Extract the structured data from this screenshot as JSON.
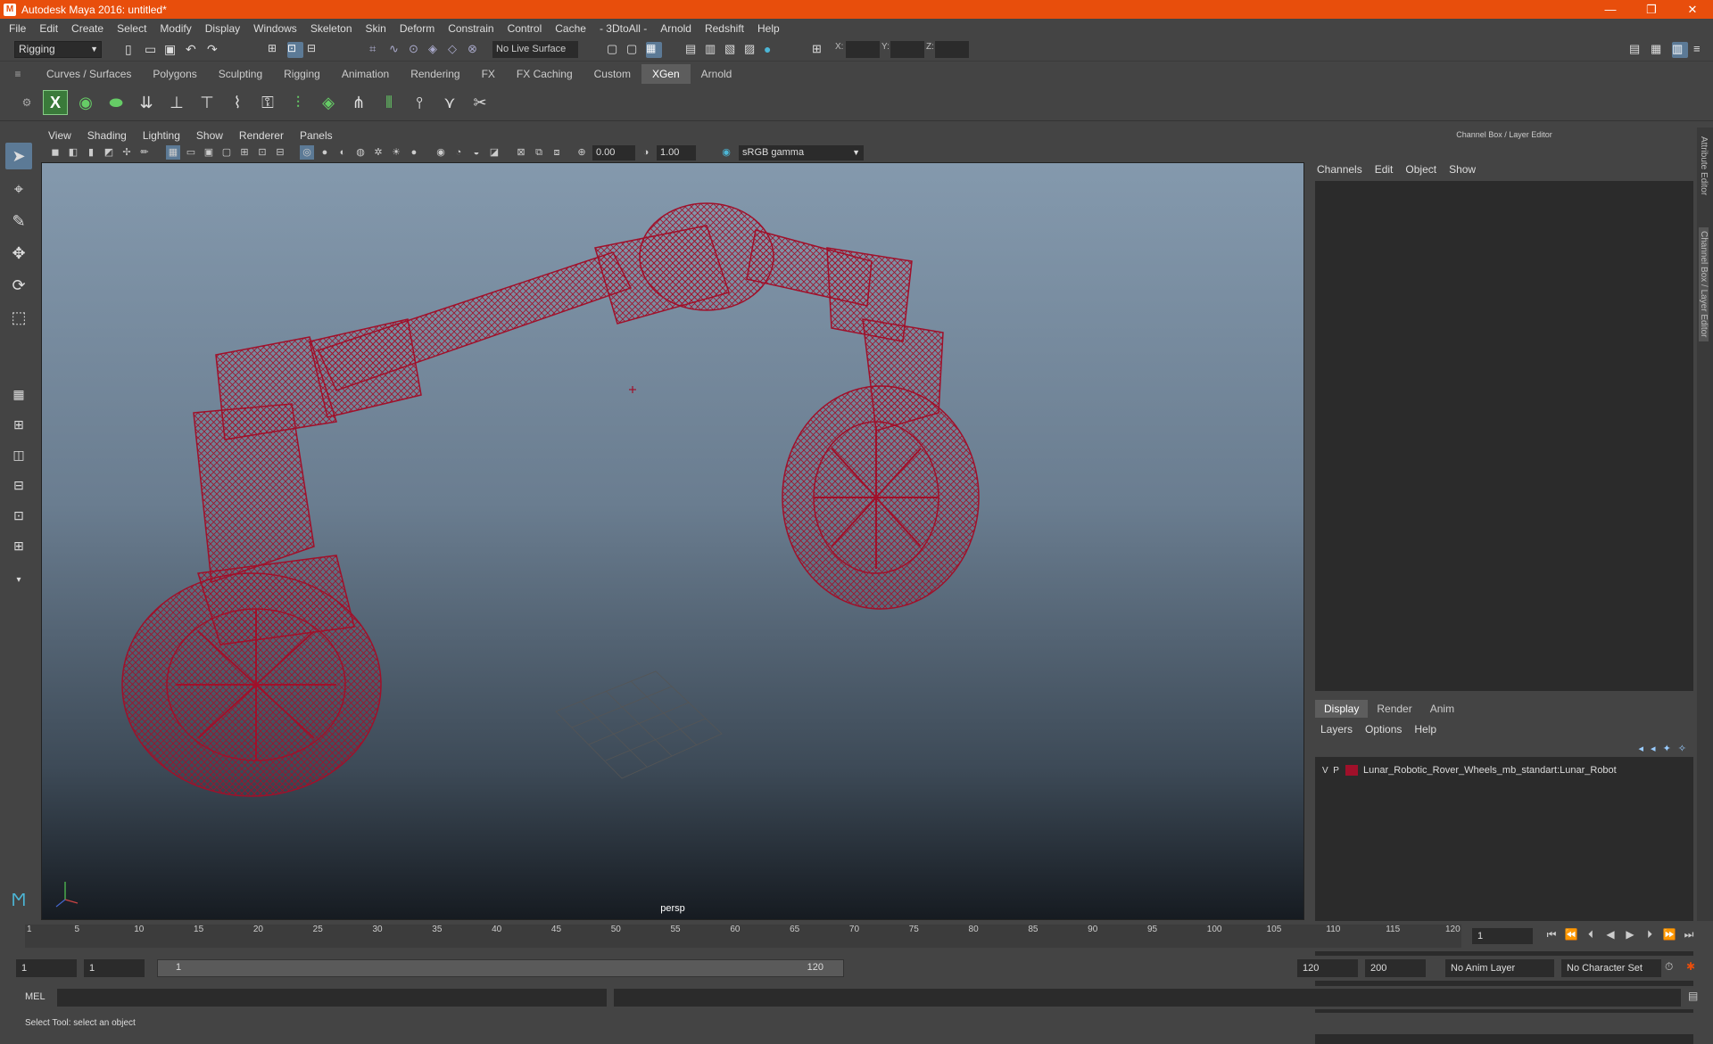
{
  "window": {
    "title": "Autodesk Maya 2016: untitled*",
    "minimize": "—",
    "restore": "❐",
    "close": "✕"
  },
  "menu": [
    "File",
    "Edit",
    "Create",
    "Select",
    "Modify",
    "Display",
    "Windows",
    "Skeleton",
    "Skin",
    "Deform",
    "Constrain",
    "Control",
    "Cache",
    "- 3DtoAll -",
    "Arnold",
    "Redshift",
    "Help"
  ],
  "status": {
    "mode": "Rigging",
    "live_surface": "No Live Surface",
    "x_label": "X:",
    "y_label": "Y:",
    "z_label": "Z:"
  },
  "shelf_tabs": [
    "Curves / Surfaces",
    "Polygons",
    "Sculpting",
    "Rigging",
    "Animation",
    "Rendering",
    "FX",
    "FX Caching",
    "Custom",
    "XGen",
    "Arnold"
  ],
  "shelf_active": "XGen",
  "viewport": {
    "menu": [
      "View",
      "Shading",
      "Lighting",
      "Show",
      "Renderer",
      "Panels"
    ],
    "exposure": "0.00",
    "gamma_value": "1.00",
    "color_space": "sRGB gamma",
    "camera": "persp"
  },
  "channel_box": {
    "title": "Channel Box / Layer Editor",
    "menu": [
      "Channels",
      "Edit",
      "Object",
      "Show"
    ]
  },
  "layer_editor": {
    "tabs": [
      "Display",
      "Render",
      "Anim"
    ],
    "menu": [
      "Layers",
      "Options",
      "Help"
    ],
    "layer": {
      "v": "V",
      "p": "P",
      "name": "Lunar_Robotic_Rover_Wheels_mb_standart:Lunar_Robot",
      "color": "#a0102a"
    }
  },
  "side_tabs": [
    "Attribute Editor",
    "Channel Box / Layer Editor"
  ],
  "timeline": {
    "ticks": [
      "1",
      "5",
      "10",
      "15",
      "20",
      "25",
      "30",
      "35",
      "40",
      "45",
      "50",
      "55",
      "60",
      "65",
      "70",
      "75",
      "80",
      "85",
      "90",
      "95",
      "100",
      "105",
      "110",
      "115",
      "120"
    ],
    "current_frame": "1"
  },
  "range": {
    "start": "1",
    "anim_start": "1",
    "slider_lo": "1",
    "slider_hi": "120",
    "anim_end": "120",
    "end": "200",
    "anim_layer": "No Anim Layer",
    "character_set": "No Character Set"
  },
  "cmd": {
    "label": "MEL"
  },
  "help": "Select Tool: select an object",
  "colors": {
    "titlebar": "#e84e0c",
    "wire": "#a0102a",
    "active_tab": "#5d5d5d"
  }
}
